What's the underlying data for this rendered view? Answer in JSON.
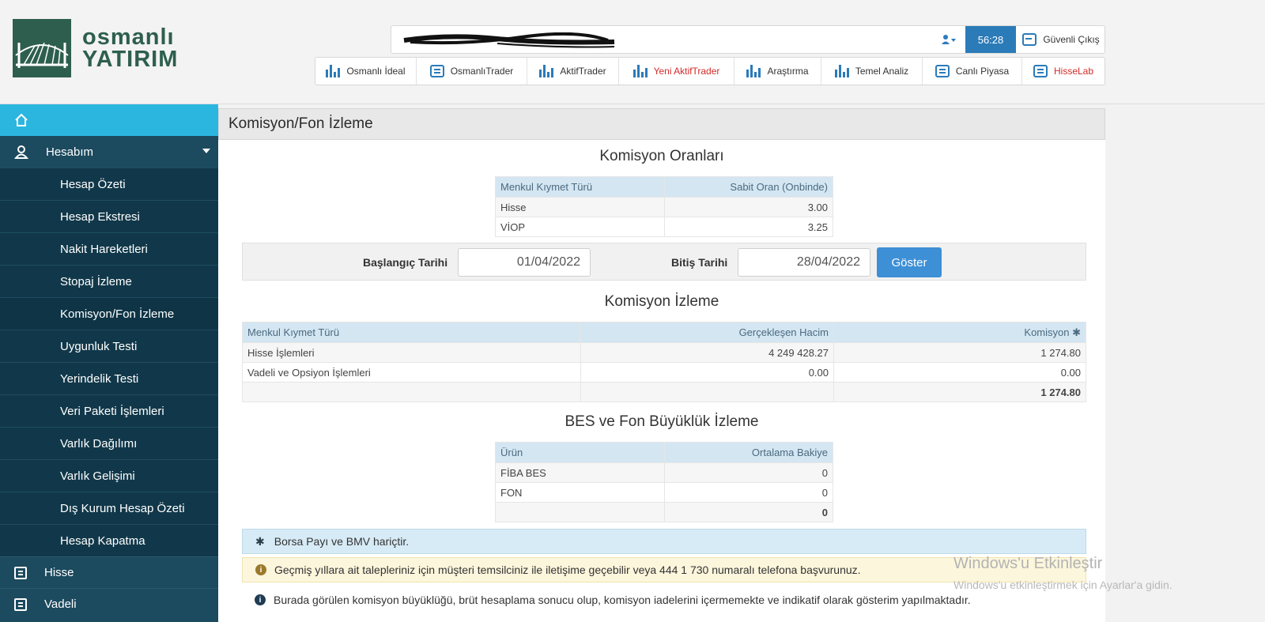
{
  "brand": {
    "line1": "osmanlı",
    "line2": "YATIRIM"
  },
  "topbar": {
    "timer": "56:28",
    "logout": "Güvenli Çıkış"
  },
  "platforms": [
    {
      "label": "Osmanlı İdeal",
      "icon": "bar-chart-icon",
      "color": "#333333"
    },
    {
      "label": "OsmanlıTrader",
      "icon": "list-icon",
      "color": "#333333"
    },
    {
      "label": "AktifTrader",
      "icon": "bar-chart-icon",
      "color": "#333333"
    },
    {
      "label": "Yeni AktifTrader",
      "icon": "bar-chart-icon",
      "color": "#d32a2a"
    },
    {
      "label": "Araştırma",
      "icon": "bar-chart-icon",
      "color": "#333333"
    },
    {
      "label": "Temel Analiz",
      "icon": "bar-chart-icon",
      "color": "#333333"
    },
    {
      "label": "Canlı Piyasa",
      "icon": "list-icon",
      "color": "#333333"
    },
    {
      "label": "HisseLab",
      "icon": "list-icon",
      "color": "#d32a2a"
    }
  ],
  "sidebar": {
    "account": "Hesabım",
    "items": [
      "Hesap Özeti",
      "Hesap Ekstresi",
      "Nakit Hareketleri",
      "Stopaj İzleme",
      "Komisyon/Fon İzleme",
      "Uygunluk Testi",
      "Yerindelik Testi",
      "Veri Paketi İşlemleri",
      "Varlık Dağılımı",
      "Varlık Gelişimi",
      "Dış Kurum Hesap Özeti",
      "Hesap Kapatma"
    ],
    "sections": [
      "Hisse",
      "Vadeli"
    ]
  },
  "page": {
    "title": "Komisyon/Fon İzleme"
  },
  "rates": {
    "title": "Komisyon Oranları",
    "headers": [
      "Menkul Kıymet Türü",
      "Sabit Oran (Onbinde)"
    ],
    "rows": [
      [
        "Hisse",
        "3.00"
      ],
      [
        "VİOP",
        "3.25"
      ]
    ]
  },
  "filter": {
    "start_label": "Başlangıç Tarihi",
    "start_value": "01/04/2022",
    "end_label": "Bitiş Tarihi",
    "end_value": "28/04/2022",
    "button": "Göster"
  },
  "tracking": {
    "title": "Komisyon İzleme",
    "headers": [
      "Menkul Kıymet Türü",
      "Gerçekleşen Hacim",
      "Komisyon ✱"
    ],
    "rows": [
      [
        "Hisse İşlemleri",
        "4 249 428.27",
        "1 274.80"
      ],
      [
        "Vadeli ve Opsiyon İşlemleri",
        "0.00",
        "0.00"
      ]
    ],
    "total": "1 274.80"
  },
  "funds": {
    "title": "BES ve Fon Büyüklük İzleme",
    "headers": [
      "Ürün",
      "Ortalama Bakiye"
    ],
    "rows": [
      [
        "FİBA BES",
        "0"
      ],
      [
        "FON",
        "0"
      ]
    ],
    "total": "0"
  },
  "notes": {
    "blue": "Borsa Payı ve BMV hariçtir.",
    "yellow": "Geçmiş yıllara ait talepleriniz için müşteri temsilciniz ile iletişime geçebilir veya 444 1 730 numaralı telefona başvurunuz.",
    "info": "Burada görülen komisyon büyüklüğü, brüt hesaplama sonucu olup, komisyon iadelerini içermemekte ve indikatif olarak gösterim yapılmaktadır."
  },
  "watermark": {
    "title": "Windows'u Etkinleştir",
    "sub": "Windows'u etkinleştirmek için Ayarlar'a gidin."
  }
}
